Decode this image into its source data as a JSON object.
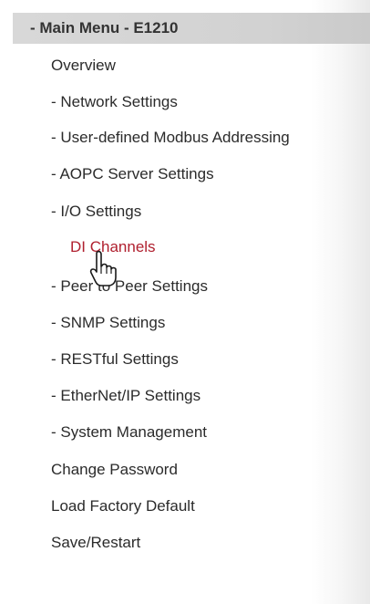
{
  "menu": {
    "header": "- Main Menu - E1210",
    "items": [
      {
        "label": "Overview"
      },
      {
        "label": "- Network Settings"
      },
      {
        "label": "- User-defined Modbus Addressing"
      },
      {
        "label": "- AOPC Server Settings"
      },
      {
        "label": "- I/O Settings"
      },
      {
        "label": "DI Channels",
        "active": true
      },
      {
        "label": "- Peer to Peer Settings"
      },
      {
        "label": "- SNMP Settings"
      },
      {
        "label": "- RESTful Settings"
      },
      {
        "label": "- EtherNet/IP Settings"
      },
      {
        "label": "- System Management"
      },
      {
        "label": "Change Password"
      },
      {
        "label": "Load Factory Default"
      },
      {
        "label": "Save/Restart"
      }
    ]
  },
  "colors": {
    "active_item": "#b0202f",
    "header_bg": "#d4d4d4",
    "text": "#2b2b2b"
  },
  "cursor_icon": "hand-pointer-icon"
}
